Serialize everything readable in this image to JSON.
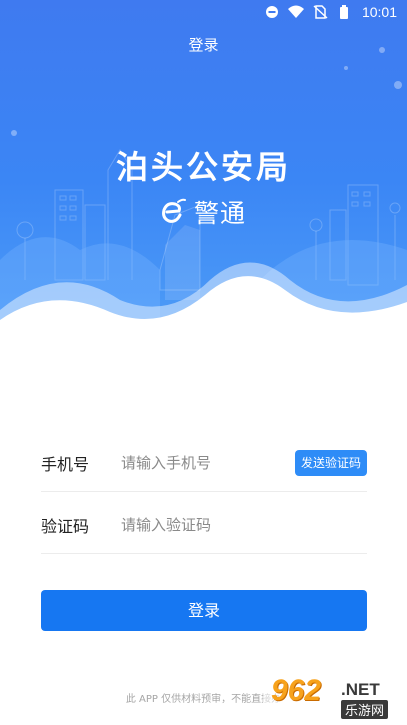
{
  "status_bar": {
    "time": "10:01",
    "icons": [
      "do-not-disturb-icon",
      "wifi-icon",
      "no-sim-icon",
      "battery-icon"
    ]
  },
  "header": {
    "title": "登录",
    "bureau_name": "泊头公安局",
    "brand_name": "警通"
  },
  "form": {
    "phone": {
      "label": "手机号",
      "placeholder": "请输入手机号"
    },
    "send_code_label": "发送验证码",
    "code": {
      "label": "验证码",
      "placeholder": "请输入验证码"
    }
  },
  "login_button": "登录",
  "disclaimer": "此 APP 仅供材料预审，不能直接办",
  "watermark": {
    "number": "962",
    "domain": ".NET",
    "site": "乐游网"
  },
  "colors": {
    "header_gradient_top": "#3f7af0",
    "header_gradient_bottom": "#4d9cf7",
    "primary_button": "#1677f2",
    "code_button": "#2e8cf7"
  }
}
